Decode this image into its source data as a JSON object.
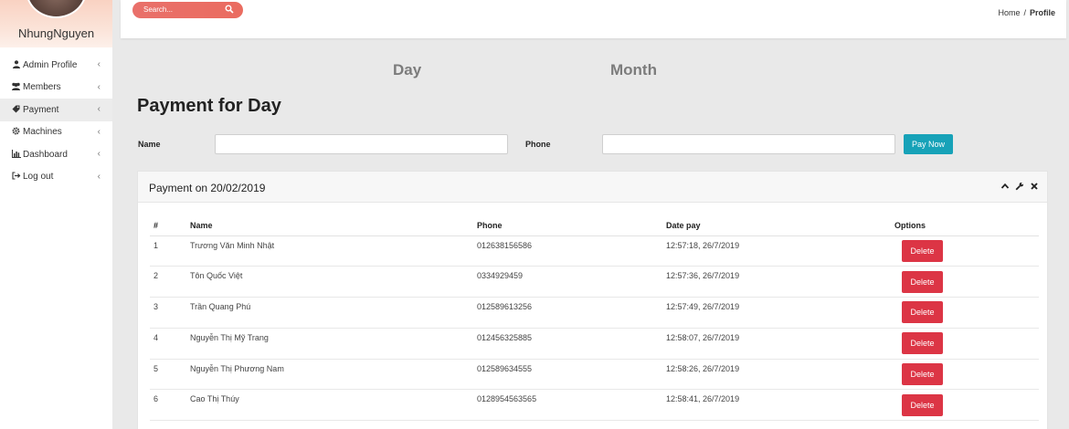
{
  "sidebar": {
    "username": "NhungNguyen",
    "items": [
      {
        "label": "Admin Profile",
        "icon": "user-icon"
      },
      {
        "label": "Members",
        "icon": "users-icon"
      },
      {
        "label": "Payment",
        "icon": "tag-icon"
      },
      {
        "label": "Machines",
        "icon": "gear-icon"
      },
      {
        "label": "Dashboard",
        "icon": "bar-chart-icon"
      },
      {
        "label": "Log out",
        "icon": "sign-out-icon"
      }
    ]
  },
  "topbar": {
    "search_placeholder": "Search...",
    "breadcrumb": {
      "home": "Home",
      "separator": "/",
      "current": "Profile"
    }
  },
  "tabs": {
    "day": "Day",
    "month": "Month"
  },
  "page_title": "Payment for Day",
  "form": {
    "name_label": "Name",
    "name_value": "",
    "phone_label": "Phone",
    "phone_value": "",
    "pay_label": "Pay Now"
  },
  "card": {
    "title": "Payment on 20/02/2019",
    "headers": [
      "#",
      "Name",
      "Phone",
      "Date pay",
      "Options"
    ],
    "rows": [
      {
        "no": "1",
        "name": "Trương Văn Minh Nhật",
        "phone": "012638156586",
        "date": "12:57:18, 26/7/2019",
        "action": "Delete"
      },
      {
        "no": "2",
        "name": "Tôn Quốc Việt",
        "phone": "0334929459",
        "date": "12:57:36, 26/7/2019",
        "action": "Delete"
      },
      {
        "no": "3",
        "name": "Trần Quang Phú",
        "phone": "012589613256",
        "date": "12:57:49, 26/7/2019",
        "action": "Delete"
      },
      {
        "no": "4",
        "name": "Nguyễn Thị Mỹ Trang",
        "phone": "012456325885",
        "date": "12:58:07, 26/7/2019",
        "action": "Delete"
      },
      {
        "no": "5",
        "name": "Nguyễn Thị Phương Nam",
        "phone": "012589634555",
        "date": "12:58:26, 26/7/2019",
        "action": "Delete"
      },
      {
        "no": "6",
        "name": "Cao Thị Thúy",
        "phone": "0128954563565",
        "date": "12:58:41, 26/7/2019",
        "action": "Delete"
      }
    ]
  },
  "colors": {
    "accent_search": "#e9706a",
    "pay_button": "#17a2b8",
    "delete_button": "#dc3545",
    "page_background": "#e9e9e9"
  }
}
